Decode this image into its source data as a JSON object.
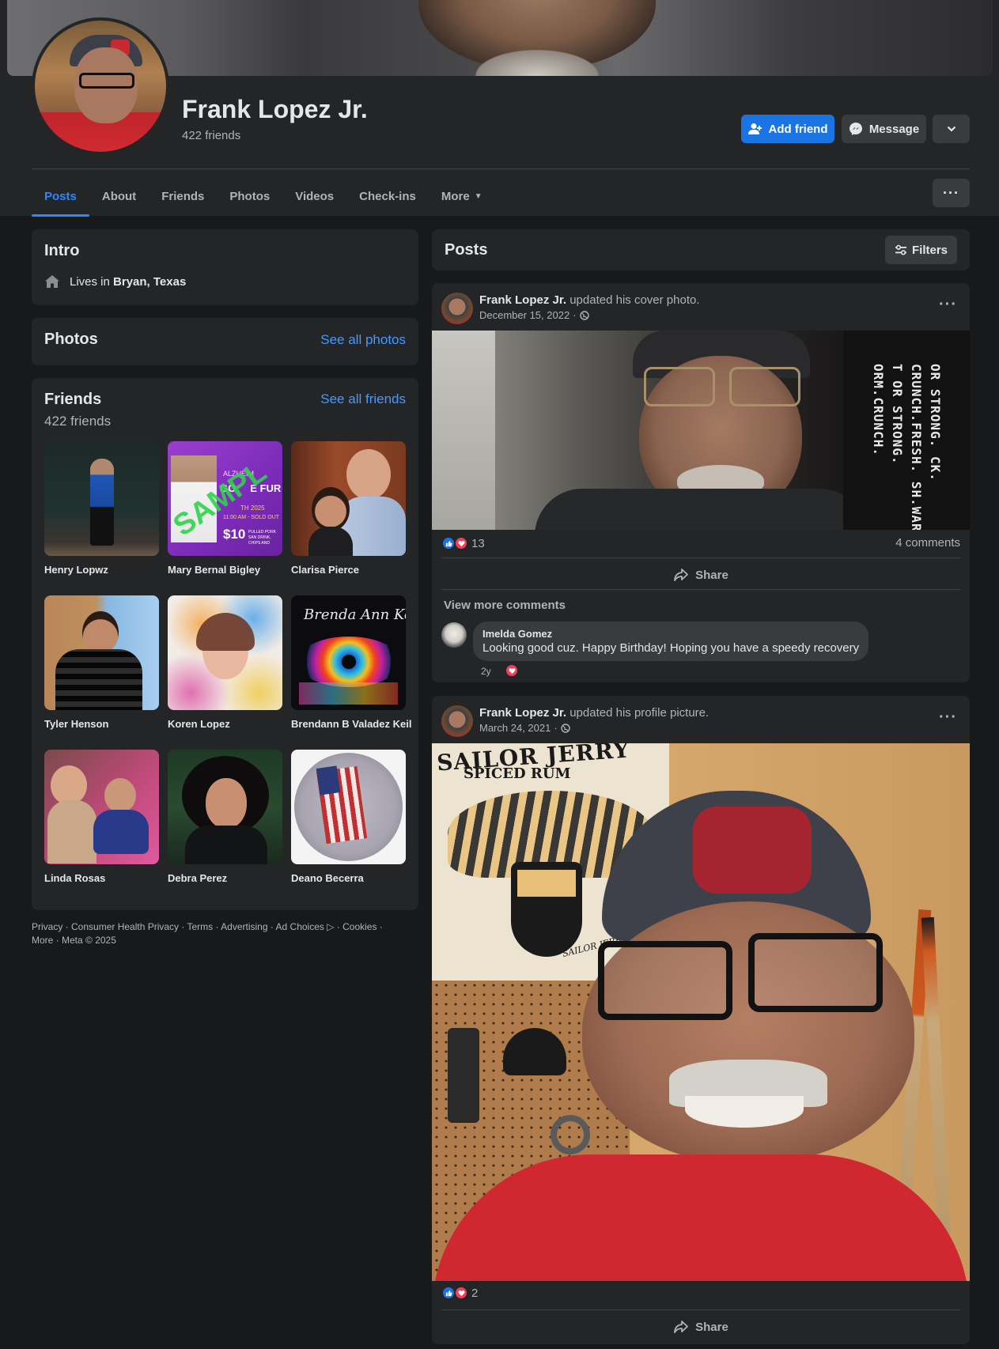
{
  "profile": {
    "name": "Frank Lopez Jr.",
    "friends_count": "422 friends"
  },
  "actions": {
    "add_friend": "Add friend",
    "message": "Message"
  },
  "tabs": [
    {
      "label": "Posts",
      "active": true
    },
    {
      "label": "About"
    },
    {
      "label": "Friends"
    },
    {
      "label": "Photos"
    },
    {
      "label": "Videos"
    },
    {
      "label": "Check-ins"
    },
    {
      "label": "More"
    }
  ],
  "intro": {
    "title": "Intro",
    "lives_prefix": "Lives in",
    "lives_place": "Bryan, Texas"
  },
  "photos": {
    "title": "Photos",
    "see_all": "See all photos"
  },
  "friends": {
    "title": "Friends",
    "see_all": "See all friends",
    "count": "422 friends",
    "list": [
      {
        "name": "Henry Lopwz"
      },
      {
        "name": "Mary Bernal Bigley",
        "photo_text": {
          "line1": "ALZHEIM",
          "line2": "GO      E FUR",
          "line3": "TH 2025",
          "line4": "11:00 AM - SOLD OUT",
          "price": "$10",
          "small": "PULLED PORK SAN DRINK, CHIPS AND",
          "watermark": "SAMPL"
        }
      },
      {
        "name": "Clarisa Pierce"
      },
      {
        "name": "Tyler Henson"
      },
      {
        "name": "Koren Lopez"
      },
      {
        "name": "Brendann B Valadez Keil",
        "photo_text": {
          "script": "Brenda Ann Keil"
        }
      },
      {
        "name": "Linda Rosas"
      },
      {
        "name": "Debra Perez"
      },
      {
        "name": "Deano Becerra"
      }
    ]
  },
  "footer": {
    "line1": "Privacy · Consumer Health Privacy · Terms · Advertising · Ad Choices ▷ · Cookies ·",
    "line2": "More · Meta © 2025"
  },
  "posts_header": {
    "title": "Posts",
    "filters": "Filters"
  },
  "posts": [
    {
      "author": "Frank Lopez Jr.",
      "action": "updated his cover photo.",
      "date": "December 15, 2022",
      "photo_text": "OR STRONG. CK. CRUNCH.FRESH. SH.WARM. T OR STRONG. ORM.CRUNCH.",
      "reactions": "13",
      "comments": "4 comments",
      "share": "Share",
      "view_more": "View more comments",
      "comment": {
        "name": "Imelda Gomez",
        "text": "Looking good cuz. Happy Birthday! Hoping you have a speedy recovery",
        "age": "2y"
      }
    },
    {
      "author": "Frank Lopez Jr.",
      "action": "updated his profile picture.",
      "date": "March 24, 2021",
      "photo_text": {
        "brand1": "SAILOR JERRY",
        "brand2": "SPICED RUM",
        "badge": "SAILOR JERRY"
      },
      "reactions": "2",
      "share": "Share"
    }
  ]
}
